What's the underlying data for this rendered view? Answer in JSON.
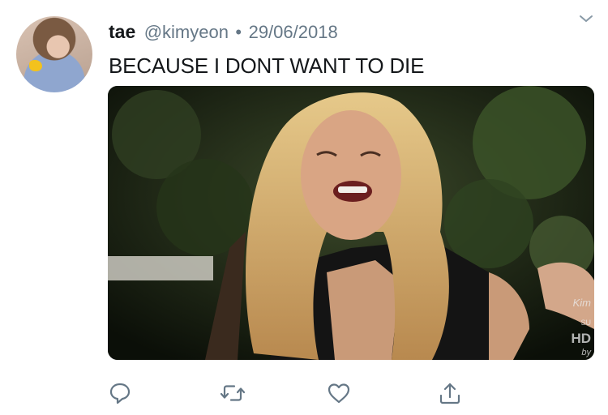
{
  "tweet": {
    "display_name": "tae",
    "handle": "@kimyeon",
    "separator": "•",
    "date": "29/06/2018",
    "text": "BECAUSE I DONT WANT TO DIE"
  },
  "media": {
    "description_icon": "image",
    "watermark": {
      "name": "Kim",
      "sub": "SU",
      "hd": "HD",
      "by": "by"
    }
  },
  "actions": [
    {
      "icon": "reply-icon"
    },
    {
      "icon": "retweet-icon"
    },
    {
      "icon": "like-icon"
    },
    {
      "icon": "share-icon"
    }
  ],
  "colors": {
    "text": "#14171a",
    "secondary": "#657786",
    "icon": "#657786",
    "background": "#ffffff"
  }
}
